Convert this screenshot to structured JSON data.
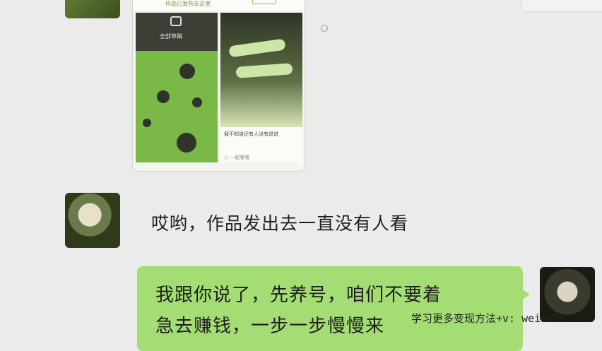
{
  "chat": {
    "shared_image": {
      "header_title": "作品已发布去这里",
      "tile_label": "全部草稿",
      "caption": "我不知道还有人没有说说",
      "meta": "○ 一起看看"
    },
    "messages": [
      {
        "side": "left",
        "text": "哎哟，作品发出去一直没有人看"
      },
      {
        "side": "right",
        "lines": [
          "我跟你说了，先养号，咱们不要着",
          "急去赚钱，一步一步慢慢来"
        ]
      }
    ]
  },
  "watermark": "学习更多变现方法+v: weike15",
  "colors": {
    "background": "#ebebeb",
    "bubble_self": "#a3dd73"
  }
}
